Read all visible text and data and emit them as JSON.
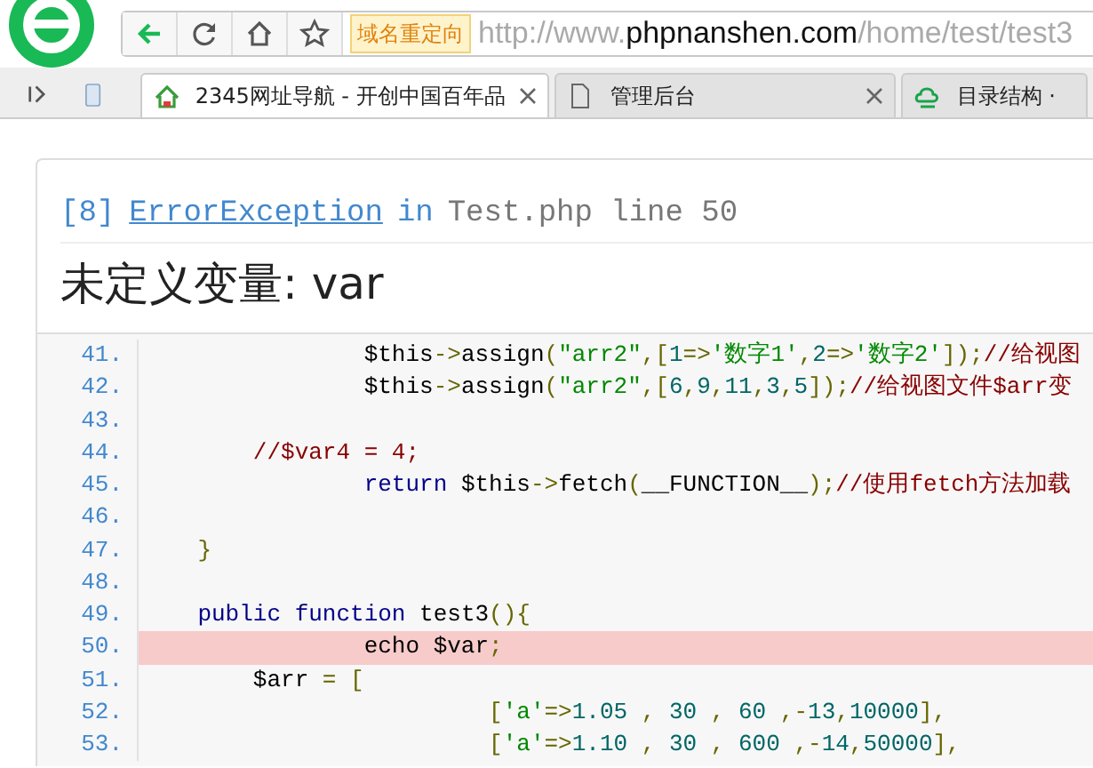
{
  "address_bar": {
    "redirect_badge": "域名重定向",
    "url": {
      "prefix": "http://www.",
      "domain": "phpnanshen.com",
      "path": "/home/test/test3"
    }
  },
  "tabs": [
    {
      "label": "2345网址导航 - 开创中国百年品",
      "selected": true,
      "kind": "house"
    },
    {
      "label": "管理后台",
      "selected": false,
      "kind": "page"
    },
    {
      "label": "目录结构 ·",
      "selected": false,
      "kind": "cloud"
    }
  ],
  "error": {
    "code": "[8]",
    "type": "ErrorException",
    "in": "in",
    "location": "Test.php line 50",
    "message": "未定义变量: var"
  },
  "code_lines": [
    {
      "number": "41.",
      "highlighted": false,
      "tokens": [
        {
          "kind": "pln",
          "text": "                $this"
        },
        {
          "kind": "pun",
          "text": "->"
        },
        {
          "kind": "pln",
          "text": "assign"
        },
        {
          "kind": "pun",
          "text": "("
        },
        {
          "kind": "str",
          "text": "\"arr2\""
        },
        {
          "kind": "pun",
          "text": ",["
        },
        {
          "kind": "lit",
          "text": "1"
        },
        {
          "kind": "pun",
          "text": "=>"
        },
        {
          "kind": "str",
          "text": "'数字1'"
        },
        {
          "kind": "pun",
          "text": ","
        },
        {
          "kind": "lit",
          "text": "2"
        },
        {
          "kind": "pun",
          "text": "=>"
        },
        {
          "kind": "str",
          "text": "'数字2'"
        },
        {
          "kind": "pun",
          "text": "]);"
        },
        {
          "kind": "com",
          "text": "//给视图"
        }
      ]
    },
    {
      "number": "42.",
      "highlighted": false,
      "tokens": [
        {
          "kind": "pln",
          "text": "                $this"
        },
        {
          "kind": "pun",
          "text": "->"
        },
        {
          "kind": "pln",
          "text": "assign"
        },
        {
          "kind": "pun",
          "text": "("
        },
        {
          "kind": "str",
          "text": "\"arr2\""
        },
        {
          "kind": "pun",
          "text": ",["
        },
        {
          "kind": "lit",
          "text": "6"
        },
        {
          "kind": "pun",
          "text": ","
        },
        {
          "kind": "lit",
          "text": "9"
        },
        {
          "kind": "pun",
          "text": ","
        },
        {
          "kind": "lit",
          "text": "11"
        },
        {
          "kind": "pun",
          "text": ","
        },
        {
          "kind": "lit",
          "text": "3"
        },
        {
          "kind": "pun",
          "text": ","
        },
        {
          "kind": "lit",
          "text": "5"
        },
        {
          "kind": "pun",
          "text": "]);"
        },
        {
          "kind": "com",
          "text": "//给视图文件$arr变"
        }
      ]
    },
    {
      "number": "43.",
      "highlighted": false
    },
    {
      "number": "44.",
      "highlighted": false,
      "tokens": [
        {
          "kind": "com",
          "text": "        //$var4 = 4;"
        }
      ]
    },
    {
      "number": "45.",
      "highlighted": false,
      "tokens": [
        {
          "kind": "kwd",
          "text": "                return"
        },
        {
          "kind": "pln",
          "text": " $this"
        },
        {
          "kind": "pun",
          "text": "->"
        },
        {
          "kind": "pln",
          "text": "fetch"
        },
        {
          "kind": "pun",
          "text": "("
        },
        {
          "kind": "pln",
          "text": "__FUNCTION__"
        },
        {
          "kind": "pun",
          "text": ");"
        },
        {
          "kind": "com",
          "text": "//使用fetch方法加载"
        }
      ]
    },
    {
      "number": "46.",
      "highlighted": false
    },
    {
      "number": "47.",
      "highlighted": false,
      "tokens": [
        {
          "kind": "pun",
          "text": "    }"
        }
      ]
    },
    {
      "number": "48.",
      "highlighted": false
    },
    {
      "number": "49.",
      "highlighted": false,
      "tokens": [
        {
          "kind": "kwd",
          "text": "    public function"
        },
        {
          "kind": "pln",
          "text": " test3"
        },
        {
          "kind": "pun",
          "text": "(){"
        }
      ]
    },
    {
      "number": "50.",
      "highlighted": true,
      "tokens": [
        {
          "kind": "pln",
          "text": "                echo $var"
        },
        {
          "kind": "pun",
          "text": ";"
        }
      ]
    },
    {
      "number": "51.",
      "highlighted": false,
      "tokens": [
        {
          "kind": "pln",
          "text": "        $arr"
        },
        {
          "kind": "pun",
          "text": " = ["
        }
      ]
    },
    {
      "number": "52.",
      "highlighted": false,
      "tokens": [
        {
          "kind": "pun",
          "text": "                         ["
        },
        {
          "kind": "str",
          "text": "'a'"
        },
        {
          "kind": "pun",
          "text": "=>"
        },
        {
          "kind": "lit",
          "text": "1.05"
        },
        {
          "kind": "pun",
          "text": " , "
        },
        {
          "kind": "lit",
          "text": "30"
        },
        {
          "kind": "pun",
          "text": " , "
        },
        {
          "kind": "lit",
          "text": "60"
        },
        {
          "kind": "pun",
          "text": " ,-"
        },
        {
          "kind": "lit",
          "text": "13"
        },
        {
          "kind": "pun",
          "text": ","
        },
        {
          "kind": "lit",
          "text": "10000"
        },
        {
          "kind": "pun",
          "text": "],"
        }
      ]
    },
    {
      "number": "53.",
      "highlighted": false,
      "tokens": [
        {
          "kind": "pun",
          "text": "                         ["
        },
        {
          "kind": "str",
          "text": "'a'"
        },
        {
          "kind": "pun",
          "text": "=>"
        },
        {
          "kind": "lit",
          "text": "1.10"
        },
        {
          "kind": "pun",
          "text": " , "
        },
        {
          "kind": "lit",
          "text": "30"
        },
        {
          "kind": "pun",
          "text": " , "
        },
        {
          "kind": "lit",
          "text": "600"
        },
        {
          "kind": "pun",
          "text": " ,-"
        },
        {
          "kind": "lit",
          "text": "14"
        },
        {
          "kind": "pun",
          "text": ","
        },
        {
          "kind": "lit",
          "text": "50000"
        },
        {
          "kind": "pun",
          "text": "],"
        }
      ]
    }
  ]
}
